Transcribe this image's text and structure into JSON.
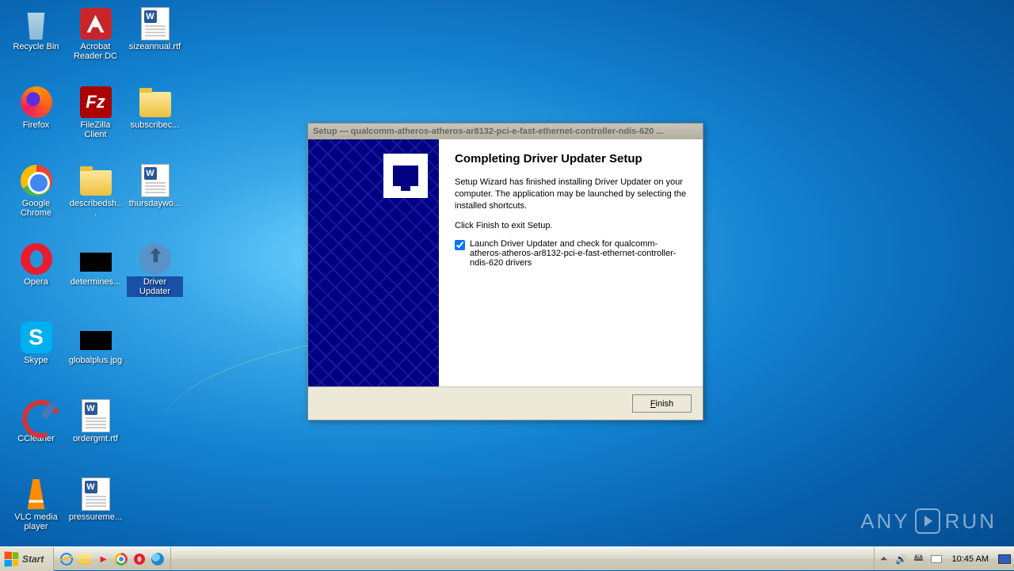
{
  "icons": [
    {
      "label": "Recycle Bin",
      "t": "bin"
    },
    {
      "label": "Acrobat Reader DC",
      "t": "adobe"
    },
    {
      "label": "sizeannual.rtf",
      "t": "word"
    },
    {
      "label": "Firefox",
      "t": "firefox"
    },
    {
      "label": "FileZilla Client",
      "t": "filez"
    },
    {
      "label": "subscribec...",
      "t": "folder"
    },
    {
      "label": "Google Chrome",
      "t": "chrome"
    },
    {
      "label": "describedsh...",
      "t": "folder"
    },
    {
      "label": "thursdaywo...",
      "t": "word"
    },
    {
      "label": "Opera",
      "t": "opera"
    },
    {
      "label": "determines...",
      "t": "black"
    },
    {
      "label": "Driver Updater",
      "t": "driverup",
      "sel": true
    },
    {
      "label": "Skype",
      "t": "skype"
    },
    {
      "label": "globalplus.jpg",
      "t": "black"
    },
    {
      "label": "",
      "t": ""
    },
    {
      "label": "CCleaner",
      "t": "cclean"
    },
    {
      "label": "ordergmt.rtf",
      "t": "word"
    },
    {
      "label": "",
      "t": ""
    },
    {
      "label": "VLC media player",
      "t": "vlc"
    },
    {
      "label": "pressureme...",
      "t": "word"
    }
  ],
  "win": {
    "title": "Setup — qualcomm-atheros-atheros-ar8132-pci-e-fast-ethernet-controller-ndis-620 ...",
    "heading": "Completing Driver Updater Setup",
    "para1": "Setup Wizard has finished installing Driver Updater on your computer. The application may be launched by selecting the installed shortcuts.",
    "para2": "Click Finish to exit Setup.",
    "checkbox": "Launch Driver Updater and check for qualcomm-atheros-atheros-ar8132-pci-e-fast-ethernet-controller-ndis-620 drivers",
    "finish": "Finish"
  },
  "taskbar": {
    "start": "Start",
    "clock": "10:45 AM"
  },
  "watermark": {
    "a": "ANY",
    "b": "RUN"
  }
}
